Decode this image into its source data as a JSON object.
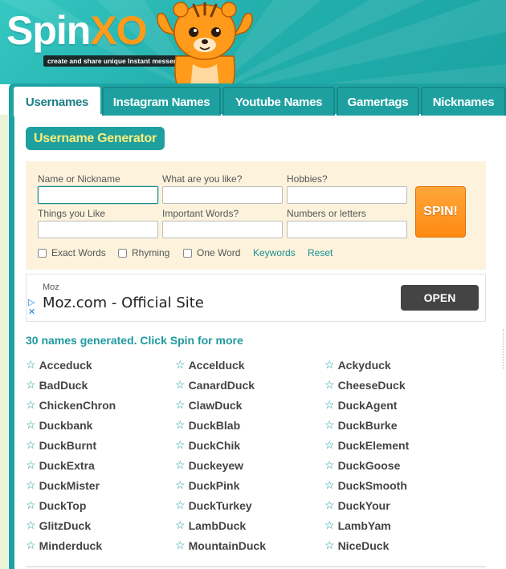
{
  "header": {
    "logo_main": "Spin",
    "logo_accent": "XO",
    "tagline": "create and share unique Instant messenger content"
  },
  "tabs": [
    {
      "label": "Usernames",
      "active": true
    },
    {
      "label": "Instagram Names",
      "active": false
    },
    {
      "label": "Youtube Names",
      "active": false
    },
    {
      "label": "Gamertags",
      "active": false
    },
    {
      "label": "Nicknames",
      "active": false
    }
  ],
  "generator": {
    "title": "Username Generator",
    "fields": [
      {
        "label": "Name or Nickname",
        "value": "",
        "placeholder": ""
      },
      {
        "label": "What are you like?",
        "value": "",
        "placeholder": ""
      },
      {
        "label": "Hobbies?",
        "value": "",
        "placeholder": ""
      },
      {
        "label": "Things you Like",
        "value": "",
        "placeholder": ""
      },
      {
        "label": "Important Words?",
        "value": "",
        "placeholder": ""
      },
      {
        "label": "Numbers or letters",
        "value": "",
        "placeholder": ""
      }
    ],
    "spin_label": "SPIN!",
    "checkboxes": [
      {
        "label": "Exact Words",
        "checked": false
      },
      {
        "label": "Rhyming",
        "checked": false
      },
      {
        "label": "One Word",
        "checked": false
      }
    ],
    "keywords_link": "Keywords",
    "reset_link": "Reset"
  },
  "ad": {
    "brand": "Moz",
    "title": "Moz.com - Official Site",
    "button": "OPEN"
  },
  "results": {
    "summary": "30 names generated. Click Spin for more",
    "names": [
      "Acceduck",
      "Accelduck",
      "Ackyduck",
      "BadDuck",
      "CanardDuck",
      "CheeseDuck",
      "ChickenChron",
      "ClawDuck",
      "DuckAgent",
      "Duckbank",
      "DuckBlab",
      "DuckBurke",
      "DuckBurnt",
      "DuckChik",
      "DuckElement",
      "DuckExtra",
      "Duckeyew",
      "DuckGoose",
      "DuckMister",
      "DuckPink",
      "DuckSmooth",
      "DuckTop",
      "DuckTurkey",
      "DuckYour",
      "GlitzDuck",
      "LambDuck",
      "LambYam",
      "Minderduck",
      "MountainDuck",
      "NiceDuck"
    ]
  },
  "colors": {
    "teal": "#1fa0a0",
    "title_yellow": "#fbee7a",
    "spin_orange": "#ff8a12",
    "form_bg": "#fdf3dc",
    "link_teal": "#1a8f94"
  },
  "icons": {
    "result_marker": "star-outline-icon",
    "ad_marker": "play-triangle-icon"
  }
}
